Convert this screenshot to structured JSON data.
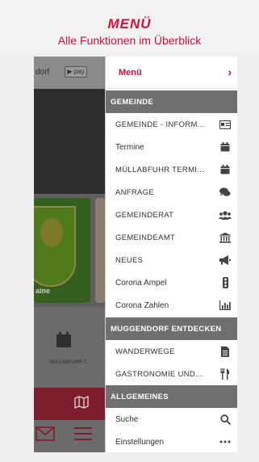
{
  "header": {
    "title": "MENÜ",
    "subtitle": "Alle Funktionen im Überblick"
  },
  "background_app": {
    "topbar_text": "dorf",
    "pay_badge": "pay",
    "card_label": "aine",
    "tile_label": "MÜLLABFUHR T...",
    "tile_icon": "trash-calendar-icon"
  },
  "menu": {
    "top_label": "Menü",
    "sections": [
      {
        "title": "GEMEINDE",
        "items": [
          {
            "label": "GEMEINDE - INFORM...",
            "icon": "id-card-icon"
          },
          {
            "label": "Termine",
            "icon": "calendar-icon"
          },
          {
            "label": "MÜLLABFUHR TERMI...",
            "icon": "calendar-icon"
          },
          {
            "label": "ANFRAGE",
            "icon": "chat-icon"
          },
          {
            "label": "GEMEINDERAT",
            "icon": "users-icon"
          },
          {
            "label": "GEMEINDEAMT",
            "icon": "building-icon"
          },
          {
            "label": "NEUES",
            "icon": "megaphone-icon"
          },
          {
            "label": "Corona Ampel",
            "icon": "traffic-light-icon"
          },
          {
            "label": "Corona Zahlen",
            "icon": "bar-chart-icon"
          }
        ]
      },
      {
        "title": "MUGGENDORF ENTDECKEN",
        "items": [
          {
            "label": "WANDERWEGE",
            "icon": "document-icon"
          },
          {
            "label": "GASTRONOMIE UND...",
            "icon": "cutlery-icon"
          }
        ]
      },
      {
        "title": "ALLGEMEINES",
        "items": [
          {
            "label": "Suche",
            "icon": "search-icon"
          },
          {
            "label": "Einstellungen",
            "icon": "more-icon"
          }
        ]
      }
    ]
  },
  "colors": {
    "accent": "#c0103a",
    "section_bg": "#6f6f6f",
    "dim_app": "#6b6b6b"
  }
}
